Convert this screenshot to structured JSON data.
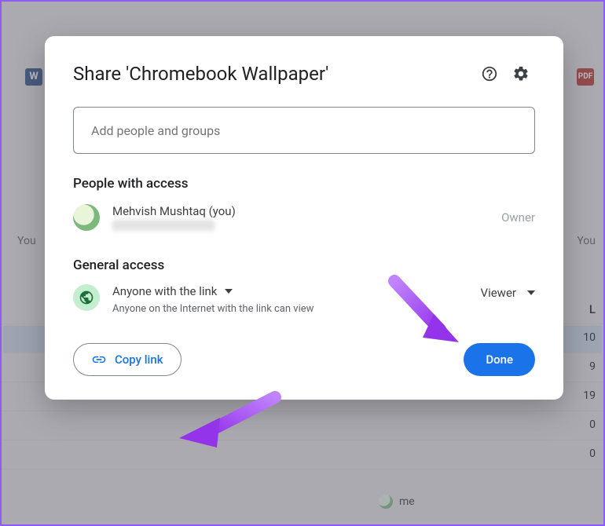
{
  "modal": {
    "title": "Share 'Chromebook Wallpaper'",
    "input_placeholder": "Add people and groups",
    "people_heading": "People with access",
    "general_heading": "General access",
    "copy_link_label": "Copy link",
    "done_label": "Done"
  },
  "owner": {
    "name": "Mehvish Mushtaq (you)",
    "role": "Owner"
  },
  "general_access": {
    "option": "Anyone with the link",
    "description": "Anyone on the Internet with the link can view",
    "permission": "Viewer"
  },
  "background": {
    "word_badge": "W",
    "pdf_badge": "PDF",
    "you_label": "You",
    "col_L": "L",
    "me_label": "me",
    "nums": [
      "10",
      "9",
      "19",
      "0",
      "0"
    ]
  }
}
